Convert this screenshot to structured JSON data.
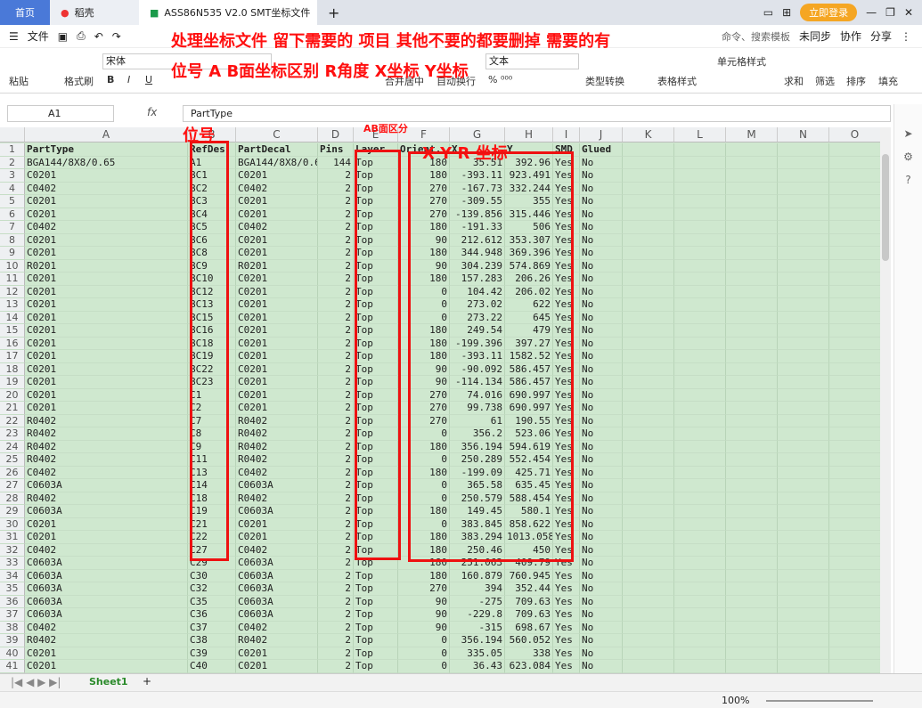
{
  "tabs": [
    {
      "label": "首页"
    },
    {
      "label": "稻壳"
    },
    {
      "label": "ASS86N535 V2.0 SMT坐标文件"
    }
  ],
  "titlebar": {
    "login_label": "立即登录"
  },
  "menu": {
    "file_label": "文件",
    "search_hint": "命令、搜索模板",
    "sync_label": "未同步",
    "collab_label": "协作",
    "share_label": "分享"
  },
  "ribbon": {
    "paste": "粘贴",
    "format_painter": "格式刷",
    "font_name": "宋体",
    "merge": "合并居中",
    "wrap": "自动换行",
    "number_format": "文本",
    "type_convert": "类型转换",
    "table_style": "表格样式",
    "cell_style": "单元格样式",
    "sum": "求和",
    "filter": "筛选",
    "sort": "排序",
    "fill": "填充"
  },
  "formula_bar": {
    "cell_ref": "A1",
    "fx": "fx",
    "content": "PartType"
  },
  "columns": [
    "A",
    "B",
    "C",
    "D",
    "E",
    "F",
    "G",
    "H",
    "I",
    "J",
    "K",
    "L",
    "M",
    "N",
    "O"
  ],
  "rows": [
    [
      "PartType",
      "RefDes",
      "PartDecal",
      "Pins",
      "Layer",
      "Orient.",
      "X",
      "Y",
      "SMD",
      "Glued"
    ],
    [
      "BGA144/8X8/0.65",
      "A1",
      "BGA144/8X8/0.6",
      "144",
      "Top",
      "180",
      "35.51",
      "392.96",
      "Yes",
      "No"
    ],
    [
      "C0201",
      "BC1",
      "C0201",
      "2",
      "Top",
      "180",
      "-393.11",
      "923.491",
      "Yes",
      "No"
    ],
    [
      "C0402",
      "BC2",
      "C0402",
      "2",
      "Top",
      "270",
      "-167.73",
      "332.244",
      "Yes",
      "No"
    ],
    [
      "C0201",
      "BC3",
      "C0201",
      "2",
      "Top",
      "270",
      "-309.55",
      "355",
      "Yes",
      "No"
    ],
    [
      "C0201",
      "BC4",
      "C0201",
      "2",
      "Top",
      "270",
      "-139.856",
      "315.446",
      "Yes",
      "No"
    ],
    [
      "C0402",
      "BC5",
      "C0402",
      "2",
      "Top",
      "180",
      "-191.33",
      "506",
      "Yes",
      "No"
    ],
    [
      "C0201",
      "BC6",
      "C0201",
      "2",
      "Top",
      "90",
      "212.612",
      "353.307",
      "Yes",
      "No"
    ],
    [
      "C0201",
      "BC8",
      "C0201",
      "2",
      "Top",
      "180",
      "344.948",
      "369.396",
      "Yes",
      "No"
    ],
    [
      "R0201",
      "BC9",
      "R0201",
      "2",
      "Top",
      "90",
      "304.239",
      "574.869",
      "Yes",
      "No"
    ],
    [
      "C0201",
      "BC10",
      "C0201",
      "2",
      "Top",
      "180",
      "157.283",
      "206.26",
      "Yes",
      "No"
    ],
    [
      "C0201",
      "BC12",
      "C0201",
      "2",
      "Top",
      "0",
      "104.42",
      "206.02",
      "Yes",
      "No"
    ],
    [
      "C0201",
      "BC13",
      "C0201",
      "2",
      "Top",
      "0",
      "273.02",
      "622",
      "Yes",
      "No"
    ],
    [
      "C0201",
      "BC15",
      "C0201",
      "2",
      "Top",
      "0",
      "273.22",
      "645",
      "Yes",
      "No"
    ],
    [
      "C0201",
      "BC16",
      "C0201",
      "2",
      "Top",
      "180",
      "249.54",
      "479",
      "Yes",
      "No"
    ],
    [
      "C0201",
      "BC18",
      "C0201",
      "2",
      "Top",
      "180",
      "-199.396",
      "397.27",
      "Yes",
      "No"
    ],
    [
      "C0201",
      "BC19",
      "C0201",
      "2",
      "Top",
      "180",
      "-393.11",
      "1582.52",
      "Yes",
      "No"
    ],
    [
      "C0201",
      "BC22",
      "C0201",
      "2",
      "Top",
      "90",
      "-90.092",
      "586.457",
      "Yes",
      "No"
    ],
    [
      "C0201",
      "BC23",
      "C0201",
      "2",
      "Top",
      "90",
      "-114.134",
      "586.457",
      "Yes",
      "No"
    ],
    [
      "C0201",
      "C1",
      "C0201",
      "2",
      "Top",
      "270",
      "74.016",
      "690.997",
      "Yes",
      "No"
    ],
    [
      "C0201",
      "C2",
      "C0201",
      "2",
      "Top",
      "270",
      "99.738",
      "690.997",
      "Yes",
      "No"
    ],
    [
      "R0402",
      "C7",
      "R0402",
      "2",
      "Top",
      "270",
      "61",
      "190.55",
      "Yes",
      "No"
    ],
    [
      "R0402",
      "C8",
      "R0402",
      "2",
      "Top",
      "0",
      "356.2",
      "523.06",
      "Yes",
      "No"
    ],
    [
      "R0402",
      "C9",
      "R0402",
      "2",
      "Top",
      "180",
      "356.194",
      "594.619",
      "Yes",
      "No"
    ],
    [
      "R0402",
      "C11",
      "R0402",
      "2",
      "Top",
      "0",
      "250.289",
      "552.454",
      "Yes",
      "No"
    ],
    [
      "C0402",
      "C13",
      "C0402",
      "2",
      "Top",
      "180",
      "-199.09",
      "425.71",
      "Yes",
      "No"
    ],
    [
      "C0603A",
      "C14",
      "C0603A",
      "2",
      "Top",
      "0",
      "365.58",
      "635.45",
      "Yes",
      "No"
    ],
    [
      "R0402",
      "C18",
      "R0402",
      "2",
      "Top",
      "0",
      "250.579",
      "588.454",
      "Yes",
      "No"
    ],
    [
      "C0603A",
      "C19",
      "C0603A",
      "2",
      "Top",
      "180",
      "149.45",
      "580.1",
      "Yes",
      "No"
    ],
    [
      "C0201",
      "C21",
      "C0201",
      "2",
      "Top",
      "0",
      "383.845",
      "858.622",
      "Yes",
      "No"
    ],
    [
      "C0201",
      "C22",
      "C0201",
      "2",
      "Top",
      "180",
      "383.294",
      "1013.058",
      "Yes",
      "No"
    ],
    [
      "C0402",
      "C27",
      "C0402",
      "2",
      "Top",
      "180",
      "250.46",
      "450",
      "Yes",
      "No"
    ],
    [
      "C0603A",
      "C29",
      "C0603A",
      "2",
      "Top",
      "180",
      "251.063",
      "409.79",
      "Yes",
      "No"
    ],
    [
      "C0603A",
      "C30",
      "C0603A",
      "2",
      "Top",
      "180",
      "160.879",
      "760.945",
      "Yes",
      "No"
    ],
    [
      "C0603A",
      "C32",
      "C0603A",
      "2",
      "Top",
      "270",
      "394",
      "352.44",
      "Yes",
      "No"
    ],
    [
      "C0603A",
      "C35",
      "C0603A",
      "2",
      "Top",
      "90",
      "-275",
      "709.63",
      "Yes",
      "No"
    ],
    [
      "C0603A",
      "C36",
      "C0603A",
      "2",
      "Top",
      "90",
      "-229.8",
      "709.63",
      "Yes",
      "No"
    ],
    [
      "C0402",
      "C37",
      "C0402",
      "2",
      "Top",
      "90",
      "-315",
      "698.67",
      "Yes",
      "No"
    ],
    [
      "R0402",
      "C38",
      "R0402",
      "2",
      "Top",
      "0",
      "356.194",
      "560.052",
      "Yes",
      "No"
    ],
    [
      "C0201",
      "C39",
      "C0201",
      "2",
      "Top",
      "0",
      "335.05",
      "338",
      "Yes",
      "No"
    ],
    [
      "C0201",
      "C40",
      "C0201",
      "2",
      "Top",
      "0",
      "36.43",
      "623.084",
      "Yes",
      "No"
    ]
  ],
  "annotations": {
    "line1": "处理坐标文件 留下需要的 项目 其他不要的都要删掉 需要的有",
    "line2": "位号 A B面坐标区别 R角度 X坐标 Y坐标",
    "refdes_label": "位号",
    "layer_label": "AB面区分",
    "xyr_label": "X Y R 坐标"
  },
  "sheet": {
    "tab_label": "Sheet1",
    "add_label": "+"
  },
  "status": {
    "zoom": "100%"
  }
}
